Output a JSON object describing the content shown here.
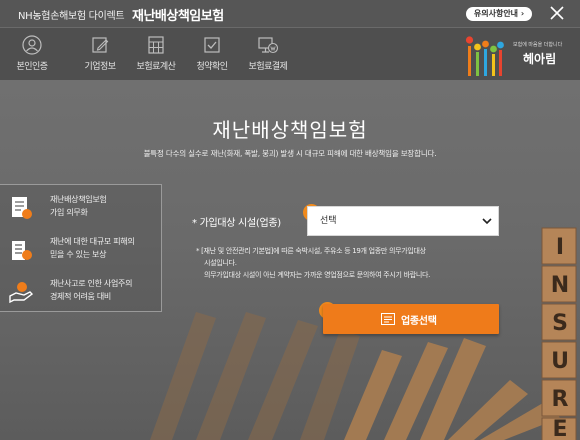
{
  "header": {
    "brand": "NH농협손해보험 다이렉트",
    "title": "재난배상책임보험",
    "notice_label": "유의사항안내 ›"
  },
  "steps": [
    {
      "label": "본인인증",
      "icon": "person-icon"
    },
    {
      "label": "기업정보",
      "icon": "edit-icon"
    },
    {
      "label": "보험료계산",
      "icon": "calculator-icon"
    },
    {
      "label": "청약확인",
      "icon": "checkbox-icon"
    },
    {
      "label": "보험료결제",
      "icon": "monitor-won-icon"
    }
  ],
  "logo": {
    "tagline": "보험에 마음을 더합니다",
    "name": "헤아림"
  },
  "main": {
    "heading": "재난배상책임보험",
    "subheading": "불특정 다수의 실수로 재난(화재, 폭발, 붕괴) 발생 시 대규모 피해에 대한 배상책임을 보장합니다."
  },
  "info_items": [
    {
      "line1": "재난배상책임보험",
      "line2": "가입 의무화",
      "icon": "document-icon"
    },
    {
      "line1": "재난에 대한 대규모 피해의",
      "line2": "믿을 수 있는 보상",
      "icon": "building-icon"
    },
    {
      "line1": "재난사고로 인한 사업주의",
      "line2": "경제적 어려움 대비",
      "icon": "coin-hand-icon"
    }
  ],
  "form": {
    "step1_badge": "1",
    "label": "* 가입대상 시설(업종)",
    "select_value": "선택",
    "note_line1": "* [재난 및 안전관리 기본법]에 따른 숙박시설, 주유소 등 19개 업종만 의무가입대상",
    "note_line2": "시설입니다.",
    "note_line3": "의무가입대상 시설이 아닌 계약자는 가까운 영업점으로 문의하여 주시기 바랍니다.",
    "step2_badge": "2",
    "submit_label": "업종선택"
  },
  "colors": {
    "accent": "#f07d1a",
    "background": "#5b5b5b"
  },
  "background_blocks_text": [
    "I",
    "N",
    "S",
    "U",
    "R",
    "E"
  ]
}
